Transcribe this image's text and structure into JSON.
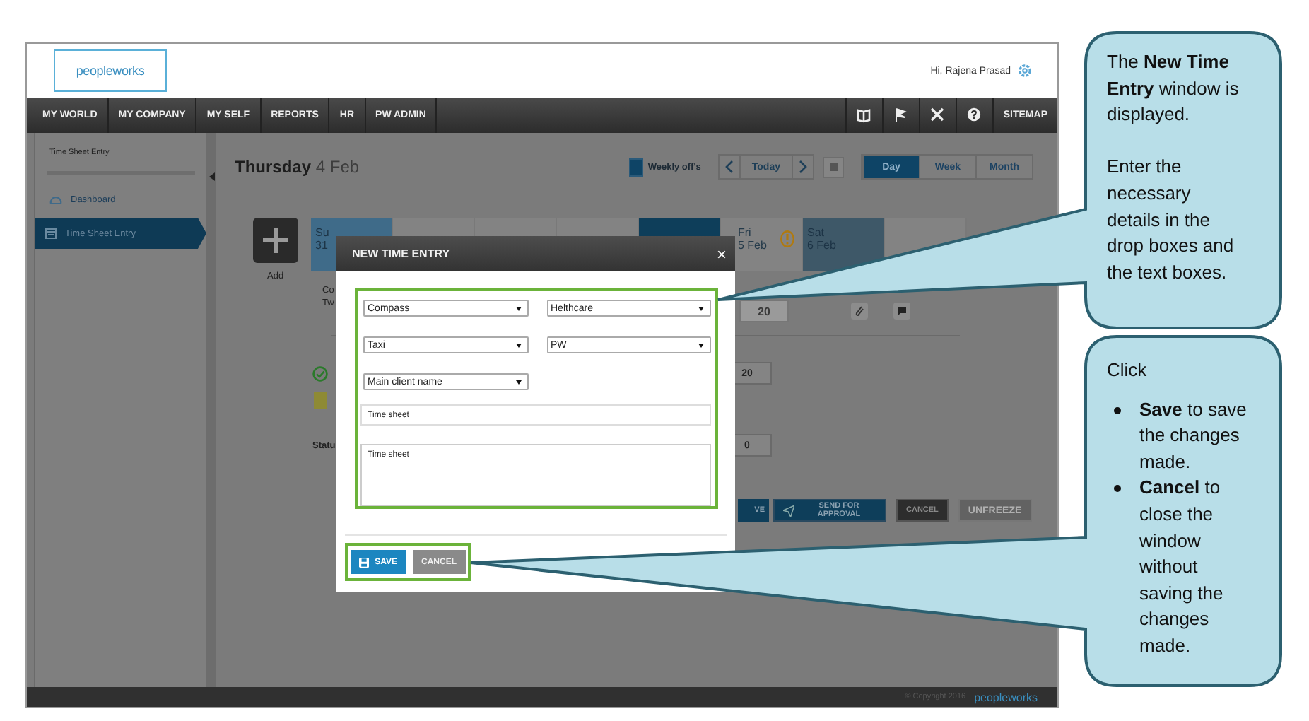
{
  "header": {
    "logo": "peopleworks",
    "greeting": "Hi, Rajena Prasad"
  },
  "nav": {
    "items": [
      "MY WORLD",
      "MY COMPANY",
      "MY SELF",
      "REPORTS",
      "HR",
      "PW ADMIN"
    ],
    "right_link": "SITEMAP"
  },
  "sidebar": {
    "title": "Time Sheet Entry",
    "items": [
      {
        "label": "Dashboard",
        "selected": false
      },
      {
        "label": "Time Sheet Entry",
        "selected": true
      }
    ]
  },
  "main": {
    "day": "Thursday",
    "date": "4 Feb",
    "legend": "Weekly off's",
    "today": "Today",
    "views": [
      {
        "label": "Day",
        "selected": true
      },
      {
        "label": "Week",
        "selected": false
      },
      {
        "label": "Month",
        "selected": false
      }
    ],
    "add_label": "Add",
    "days": [
      {
        "kind": "weekly_off",
        "name": "Su",
        "date": "31"
      },
      {
        "kind": "normal"
      },
      {
        "kind": "normal"
      },
      {
        "kind": "normal"
      },
      {
        "kind": "selected"
      },
      {
        "kind": "normal",
        "name": "Fri",
        "date": "5 Feb",
        "warning": true
      },
      {
        "kind": "weekly_off",
        "name": "Sat",
        "date": "6 Feb"
      },
      {
        "kind": "normal"
      }
    ],
    "entry_fragment": [
      "Co",
      "Tw"
    ],
    "entry_hours": "20",
    "total_hours": "20",
    "pending_hours": "0",
    "status_label": "Statu",
    "actions": [
      {
        "label": "VE",
        "kind": "primary"
      },
      {
        "label": "SEND FOR APPROVAL",
        "kind": "send"
      },
      {
        "label": "CANCEL",
        "kind": "dark"
      },
      {
        "label": "UNFREEZE",
        "kind": "disabled"
      }
    ]
  },
  "dialog": {
    "title": "NEW TIME ENTRY",
    "close": "×",
    "dropdowns": [
      [
        "Compass",
        "Helthcare"
      ],
      [
        "Taxi",
        "PW"
      ],
      [
        "Main client name"
      ]
    ],
    "title_field": "Time sheet",
    "description": "Time sheet",
    "buttons": [
      {
        "label": "SAVE",
        "kind": "save"
      },
      {
        "label": "CANCEL",
        "kind": "cancel"
      }
    ]
  },
  "footer": {
    "copyright": "© Copyright 2016",
    "logo": "peopleworks"
  },
  "callouts": [
    {
      "paragraphs": [
        "The **New Time Entry** window is displayed.",
        "Enter the necessary details in the drop boxes and the text boxes."
      ]
    },
    {
      "intro": "Click",
      "bullets": [
        "**Save** to save the changes made.",
        "**Cancel** to close the window without saving the changes made."
      ]
    }
  ]
}
